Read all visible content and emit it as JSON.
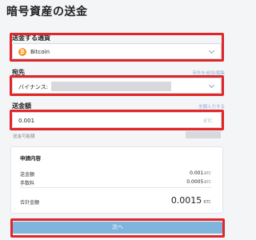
{
  "page": {
    "title": "暗号資産の送金"
  },
  "currency": {
    "label": "送金する通貨",
    "icon": "bitcoin-icon",
    "icon_glyph": "₿",
    "selected": "Bitcoin"
  },
  "destination": {
    "label": "宛先",
    "add_edit_link": "宛先を追加/編集",
    "selected_prefix": "バイナンス:"
  },
  "amount": {
    "label": "送金額",
    "send_all_link": "全額入力する",
    "value": "0.001",
    "unit": "BTC",
    "available_label": "送金可能額"
  },
  "summary": {
    "title": "申請内容",
    "rows": [
      {
        "label": "送金額",
        "value": "0.001",
        "unit": "BTC"
      },
      {
        "label": "手数料",
        "value": "0.0005",
        "unit": "BTC"
      }
    ],
    "total_label": "合計金額",
    "total_value": "0.0015",
    "total_unit": "BTC"
  },
  "next_button": {
    "label": "次へ"
  },
  "colors": {
    "highlight": "#e0262b",
    "button": "#7fb4dd",
    "link": "#8ab0d8",
    "bitcoin": "#f7931a"
  }
}
